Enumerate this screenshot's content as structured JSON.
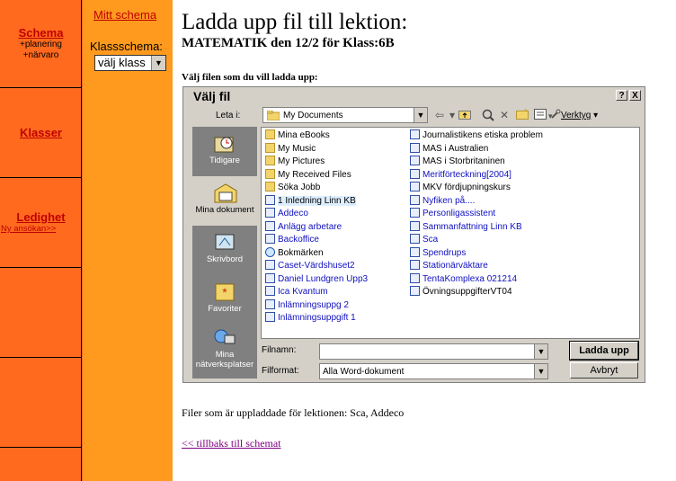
{
  "nav": {
    "schema": "Schema",
    "schema_sub1": "+planering",
    "schema_sub2": "+närvaro",
    "klasser": "Klasser",
    "ledighet": "Ledighet",
    "ny_ansokan": "Ny ansökan>>"
  },
  "col2": {
    "mitt_schema": "Mitt schema",
    "klassschema_label": "Klassschema:",
    "klass_select_value": "välj klass"
  },
  "main": {
    "title": "Ladda upp fil till lektion:",
    "subtitle": "MATEMATIK den 12/2 för Klass:6B",
    "choose_label": "Välj filen som du vill ladda upp:",
    "uploaded_files": "Filer som är uppladdade för lektionen: Sca, Addeco",
    "back_link": "<< tillbaks till schemat"
  },
  "dialog": {
    "title": "Välj fil",
    "help_btn": "?",
    "close_btn": "X",
    "leta_label": "Leta i:",
    "leta_value": "My Documents",
    "verktyg": "Verktyg",
    "places": [
      {
        "label": "Tidigare",
        "icon": "history-icon"
      },
      {
        "label": "Mina dokument",
        "icon": "my-documents-icon"
      },
      {
        "label": "Skrivbord",
        "icon": "desktop-icon"
      },
      {
        "label": "Favoriter",
        "icon": "favorites-icon"
      },
      {
        "label": "Mina nätverksplatser",
        "icon": "network-places-icon"
      }
    ],
    "files_col1": [
      {
        "name": "Mina eBooks",
        "kind": "folder"
      },
      {
        "name": "My Music",
        "kind": "folder"
      },
      {
        "name": "My Pictures",
        "kind": "folder"
      },
      {
        "name": "My Received Files",
        "kind": "folder"
      },
      {
        "name": "Söka Jobb",
        "kind": "folder"
      },
      {
        "name": "1 Inledning Linn KB",
        "kind": "doc"
      },
      {
        "name": "Addeco",
        "kind": "doc"
      },
      {
        "name": "Anlägg arbetare",
        "kind": "doc"
      },
      {
        "name": "Backoffice",
        "kind": "doc"
      },
      {
        "name": "Bokmärken",
        "kind": "url"
      },
      {
        "name": "Caset-Värdshuset2",
        "kind": "doc"
      },
      {
        "name": "Daniel Lundgren Upp3",
        "kind": "doc"
      },
      {
        "name": "Ica Kvantum",
        "kind": "doc"
      },
      {
        "name": "Inlämningsuppg 2",
        "kind": "doc"
      },
      {
        "name": "Inlämningsuppgift 1",
        "kind": "doc"
      }
    ],
    "files_col2": [
      {
        "name": "Journalistikens etiska problem",
        "kind": "doc"
      },
      {
        "name": "MAS i Australien",
        "kind": "doc"
      },
      {
        "name": "MAS i Storbritaninen",
        "kind": "doc"
      },
      {
        "name": "Meritförteckning[2004]",
        "kind": "doc"
      },
      {
        "name": "MKV fördjupningskurs",
        "kind": "doc"
      },
      {
        "name": "Nyfiken på....",
        "kind": "doc"
      },
      {
        "name": "Personligassistent",
        "kind": "doc"
      },
      {
        "name": "Sammanfattning Linn KB",
        "kind": "doc"
      },
      {
        "name": "Sca",
        "kind": "doc"
      },
      {
        "name": "Spendrups",
        "kind": "doc"
      },
      {
        "name": "Stationärväktare",
        "kind": "doc"
      },
      {
        "name": "TentaKomplexa 021214",
        "kind": "doc"
      },
      {
        "name": "ÖvningsuppgifterVT04",
        "kind": "doc"
      }
    ],
    "filnamn_label": "Filnamn:",
    "filnamn_value": "",
    "filformat_label": "Filformat:",
    "filformat_value": "Alla Word-dokument",
    "upload_btn": "Ladda upp",
    "cancel_btn": "Avbryt"
  }
}
